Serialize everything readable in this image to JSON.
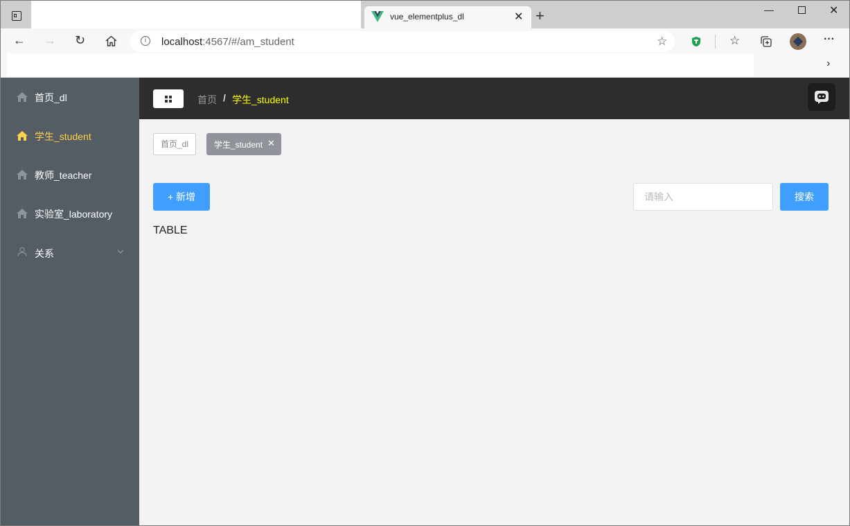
{
  "browser": {
    "tab_title": "vue_elementplus_dl",
    "new_tab_symbol": "+",
    "address_host": "localhost",
    "address_rest": ":4567/#/am_student",
    "window_controls": [
      "minimize-icon",
      "maximize-icon",
      "close-icon"
    ]
  },
  "sidebar": {
    "background": "#545c64",
    "active_color": "#ffd04b",
    "items": [
      {
        "label": "首页_dl",
        "icon": "home-icon"
      },
      {
        "label": "学生_student",
        "icon": "home-icon",
        "active": true
      },
      {
        "label": "教师_teacher",
        "icon": "home-icon"
      },
      {
        "label": "实验室_laboratory",
        "icon": "home-icon"
      },
      {
        "label": "关系",
        "icon": "user-icon",
        "expandable": true
      }
    ]
  },
  "header": {
    "breadcrumb_home": "首页",
    "breadcrumb_separator": "/",
    "breadcrumb_current": "学生_student",
    "current_color": "#ffff00"
  },
  "tags": {
    "home": "首页_dl",
    "active": "学生_student"
  },
  "actions": {
    "add_label": "+ 新增",
    "search_placeholder": "请输入",
    "search_label": "搜索",
    "accent": "#409eff"
  },
  "content": {
    "table_placeholder": "TABLE"
  }
}
